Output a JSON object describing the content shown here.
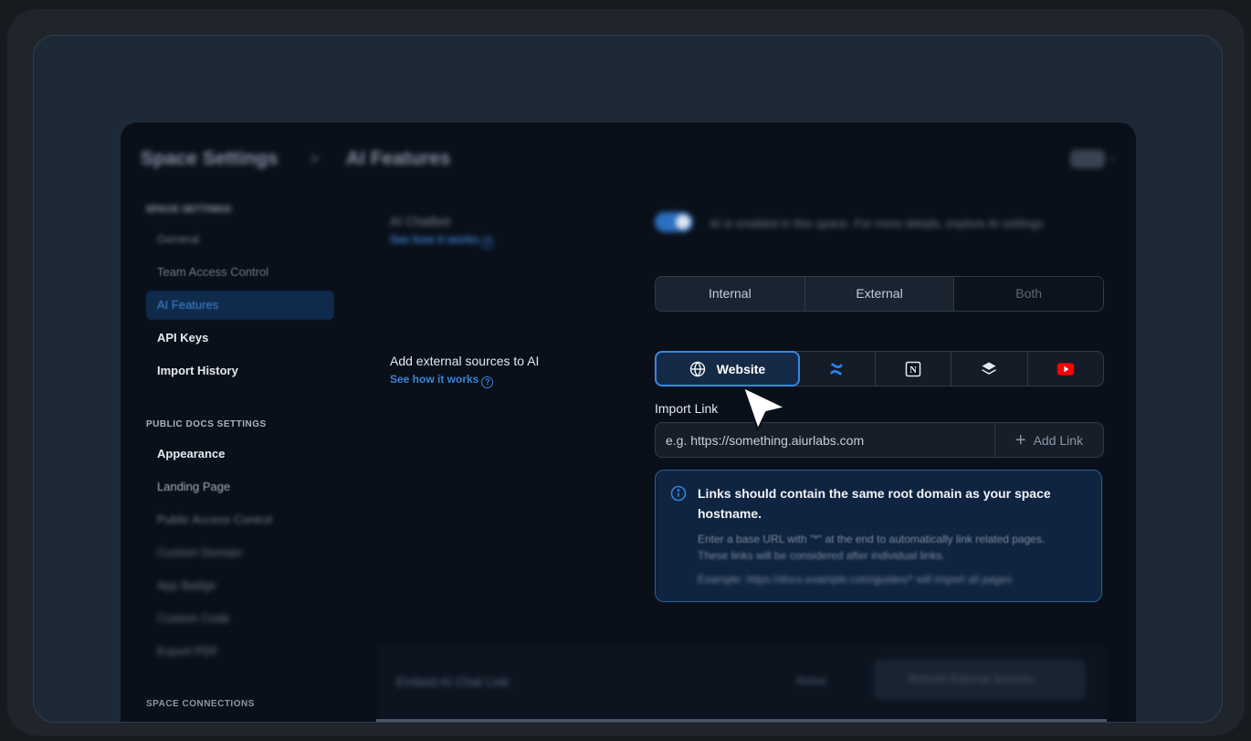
{
  "header": {
    "title": "Space Settings",
    "separator": ">",
    "page": "AI Features"
  },
  "sidebar": {
    "section1_heading": "SPACE SETTINGS",
    "items1": [
      {
        "label": "General"
      },
      {
        "label": "Team Access Control"
      },
      {
        "label": "AI Features"
      },
      {
        "label": "API Keys"
      },
      {
        "label": "Import History"
      }
    ],
    "section2_heading": "PUBLIC DOCS SETTINGS",
    "items2": [
      {
        "label": "Appearance"
      },
      {
        "label": "Landing Page"
      },
      {
        "label": "Public Access Control"
      },
      {
        "label": "Custom Domain"
      },
      {
        "label": "App Badge"
      },
      {
        "label": "Custom Code"
      },
      {
        "label": "Export PDF"
      }
    ],
    "section3_heading": "SPACE CONNECTIONS"
  },
  "ai_toggle": {
    "label": "AI Chatbot",
    "link": "See how it works",
    "description": "AI is enabled in this space. For more details, explore AI settings"
  },
  "mode_segment": {
    "options": [
      "Internal",
      "External",
      "Both"
    ]
  },
  "external_sources": {
    "label": "Add external sources to AI",
    "link": "See how it works",
    "tabs": {
      "website": "Website"
    }
  },
  "import": {
    "label": "Import Link",
    "placeholder": "e.g. https://something.aiurlabs.com",
    "add_button": "Add Link"
  },
  "info_box": {
    "title": "Links should contain the same root domain as your space hostname.",
    "body_line1": "Enter a base URL with \"*\" at the end to automatically link related pages.",
    "body_line2": "These links will be considered after individual links.",
    "body_line3": "Example: https://docs.example.com/guides/* will import all pages"
  },
  "bottom": {
    "title": "Embed AI Chat Link",
    "status": "Active",
    "button": "Refresh External Sources"
  },
  "colors": {
    "accent": "#3b82d6",
    "background": "#0a101a"
  }
}
